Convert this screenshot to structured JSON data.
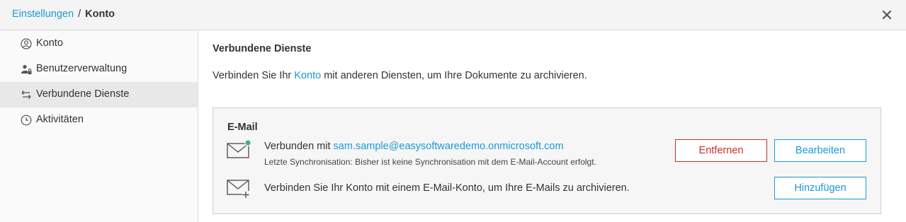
{
  "breadcrumb": {
    "parent": "Einstellungen",
    "separator": "/",
    "current": "Konto"
  },
  "sidebar": {
    "items": [
      {
        "label": "Konto",
        "icon": "user-circle-icon"
      },
      {
        "label": "Benutzerverwaltung",
        "icon": "user-lock-icon"
      },
      {
        "label": "Verbundene Dienste",
        "icon": "arrows-swap-icon",
        "active": true
      },
      {
        "label": "Aktivitäten",
        "icon": "clock-icon"
      }
    ]
  },
  "main": {
    "title": "Verbundene Dienste",
    "intro_prefix": "Verbinden Sie Ihr ",
    "intro_link": "Konto",
    "intro_suffix": " mit anderen Diensten, um Ihre Dokumente zu archivieren."
  },
  "email_card": {
    "title": "E-Mail",
    "connected_prefix": "Verbunden mit ",
    "connected_email": "sam.sample@easysoftwaredemo.onmicrosoft.com",
    "sync_status": "Letzte Synchronisation: Bisher ist keine Synchronisation mit dem E-Mail-Account erfolgt.",
    "remove_label": "Entfernen",
    "edit_label": "Bearbeiten",
    "add_text": "Verbinden Sie Ihr Konto mit einem E-Mail-Konto, um Ihre E-Mails zu archivieren.",
    "add_label": "Hinzufügen"
  },
  "colors": {
    "accent": "#1a9ad6",
    "danger": "#c9302c",
    "connected": "#4caf7a"
  }
}
